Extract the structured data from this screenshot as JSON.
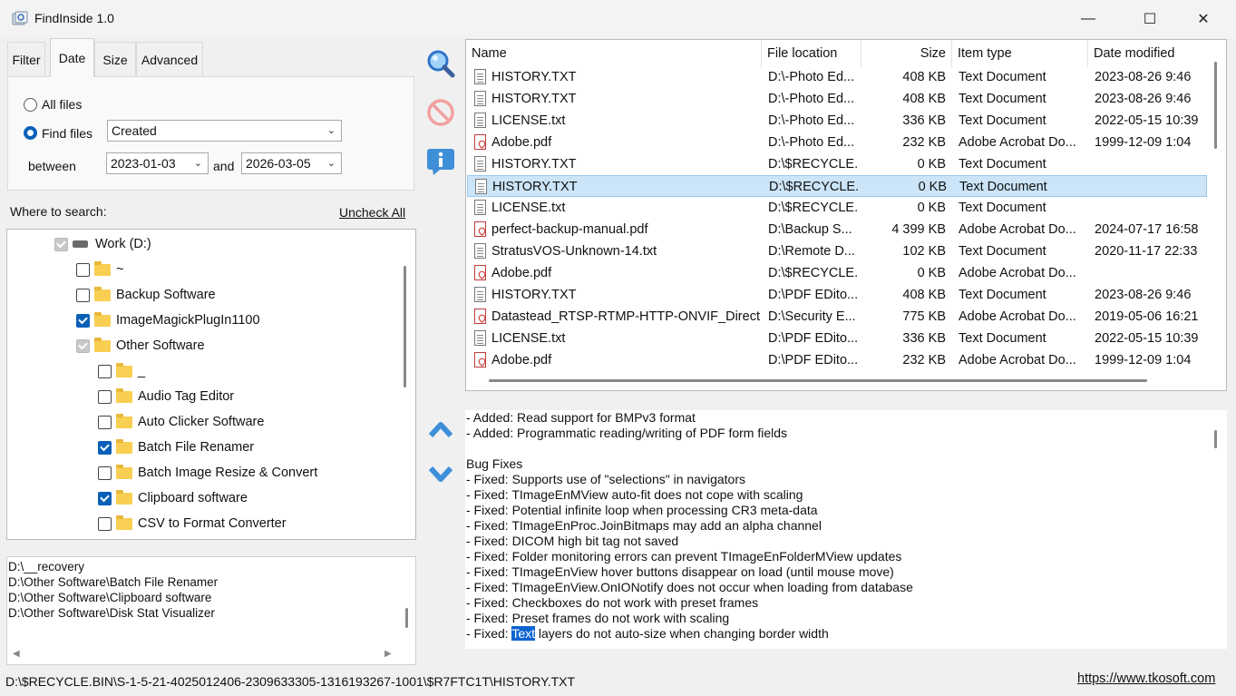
{
  "window": {
    "title": "FindInside 1.0",
    "minimize": "—",
    "maximize": "☐",
    "close": "✕"
  },
  "tabs": [
    {
      "label": "Filter"
    },
    {
      "label": "Date"
    },
    {
      "label": "Size"
    },
    {
      "label": "Advanced"
    }
  ],
  "date_filter": {
    "all_files_label": "All files",
    "find_files_label": "Find files",
    "mode_value": "Created",
    "between_label": "between",
    "start_date": "2023-01-03",
    "and_label": "and",
    "end_date": "2026-03-05"
  },
  "where_to_search": {
    "label": "Where to search:",
    "uncheck_all": "Uncheck All"
  },
  "tree": [
    {
      "label": "Work (D:)",
      "state": "gray",
      "level": 0,
      "kind": "drive"
    },
    {
      "label": "~",
      "state": "unchecked",
      "level": 1,
      "kind": "folder"
    },
    {
      "label": "Backup Software",
      "state": "unchecked",
      "level": 1,
      "kind": "folder"
    },
    {
      "label": "ImageMagickPlugIn1100",
      "state": "checked",
      "level": 1,
      "kind": "folder"
    },
    {
      "label": "Other Software",
      "state": "gray",
      "level": 1,
      "kind": "folder"
    },
    {
      "label": "_",
      "state": "unchecked",
      "level": 2,
      "kind": "folder"
    },
    {
      "label": "Audio Tag Editor",
      "state": "unchecked",
      "level": 2,
      "kind": "folder"
    },
    {
      "label": "Auto Clicker Software",
      "state": "unchecked",
      "level": 2,
      "kind": "folder"
    },
    {
      "label": "Batch File Renamer",
      "state": "checked",
      "level": 2,
      "kind": "folder"
    },
    {
      "label": "Batch Image Resize & Convert",
      "state": "unchecked",
      "level": 2,
      "kind": "folder"
    },
    {
      "label": "Clipboard software",
      "state": "checked",
      "level": 2,
      "kind": "folder"
    },
    {
      "label": "CSV to Format Converter",
      "state": "unchecked",
      "level": 2,
      "kind": "folder"
    }
  ],
  "search_paths": [
    "D:\\__recovery",
    "D:\\Other Software\\Batch File Renamer",
    "D:\\Other Software\\Clipboard software",
    "D:\\Other Software\\Disk Stat Visualizer"
  ],
  "side_buttons": {
    "search": "search-icon",
    "stop": "stop-icon",
    "info": "info-icon",
    "up": "chevron-up-icon",
    "down": "chevron-down-icon"
  },
  "file_columns": [
    "Name",
    "File location",
    "Size",
    "Item type",
    "Date modified"
  ],
  "files": [
    {
      "name": "HISTORY.TXT",
      "location": "D:\\-Photo Ed...",
      "size": "408 KB",
      "type": "Text Document",
      "date": "2023-08-26 9:46",
      "icon": "txt"
    },
    {
      "name": "HISTORY.TXT",
      "location": "D:\\-Photo Ed...",
      "size": "408 KB",
      "type": "Text Document",
      "date": "2023-08-26 9:46",
      "icon": "txt"
    },
    {
      "name": "LICENSE.txt",
      "location": "D:\\-Photo Ed...",
      "size": "336 KB",
      "type": "Text Document",
      "date": "2022-05-15 10:39",
      "icon": "txt"
    },
    {
      "name": "Adobe.pdf",
      "location": "D:\\-Photo Ed...",
      "size": "232 KB",
      "type": "Adobe Acrobat Do...",
      "date": "1999-12-09 1:04",
      "icon": "pdf"
    },
    {
      "name": "HISTORY.TXT",
      "location": "D:\\$RECYCLE...",
      "size": "0 KB",
      "type": "Text Document",
      "date": "",
      "icon": "txt"
    },
    {
      "name": "HISTORY.TXT",
      "location": "D:\\$RECYCLE...",
      "size": "0 KB",
      "type": "Text Document",
      "date": "",
      "icon": "txt",
      "selected": true
    },
    {
      "name": "LICENSE.txt",
      "location": "D:\\$RECYCLE...",
      "size": "0 KB",
      "type": "Text Document",
      "date": "",
      "icon": "txt"
    },
    {
      "name": "perfect-backup-manual.pdf",
      "location": "D:\\Backup S...",
      "size": "4 399 KB",
      "type": "Adobe Acrobat Do...",
      "date": "2024-07-17 16:58",
      "icon": "pdf"
    },
    {
      "name": "StratusVOS-Unknown-14.txt",
      "location": "D:\\Remote D...",
      "size": "102 KB",
      "type": "Text Document",
      "date": "2020-11-17 22:33",
      "icon": "txt"
    },
    {
      "name": "Adobe.pdf",
      "location": "D:\\$RECYCLE...",
      "size": "0 KB",
      "type": "Adobe Acrobat Do...",
      "date": "",
      "icon": "pdf"
    },
    {
      "name": "HISTORY.TXT",
      "location": "D:\\PDF EDito...",
      "size": "408 KB",
      "type": "Text Document",
      "date": "2023-08-26 9:46",
      "icon": "txt"
    },
    {
      "name": "Datastead_RTSP-RTMP-HTTP-ONVIF_Direct...",
      "location": "D:\\Security E...",
      "size": "775 KB",
      "type": "Adobe Acrobat Do...",
      "date": "2019-05-06 16:21",
      "icon": "pdf"
    },
    {
      "name": "LICENSE.txt",
      "location": "D:\\PDF EDito...",
      "size": "336 KB",
      "type": "Text Document",
      "date": "2022-05-15 10:39",
      "icon": "txt"
    },
    {
      "name": "Adobe.pdf",
      "location": "D:\\PDF EDito...",
      "size": "232 KB",
      "type": "Adobe Acrobat Do...",
      "date": "1999-12-09 1:04",
      "icon": "pdf"
    }
  ],
  "preview_lines": [
    "- Added: Read support for BMPv3 format",
    "- Added: Programmatic reading/writing of PDF form fields",
    "",
    "Bug Fixes",
    "- Fixed: Supports use of \"selections\" in navigators",
    "- Fixed: TImageEnMView auto-fit does not cope with scaling",
    "- Fixed: Potential infinite loop when processing CR3 meta-data",
    "- Fixed: TImageEnProc.JoinBitmaps may add an alpha channel",
    "- Fixed: DICOM high bit tag not saved",
    "- Fixed: Folder monitoring errors can prevent TImageEnFolderMView updates",
    "- Fixed: TImageEnView hover buttons disappear on load (until mouse move)",
    "- Fixed: TImageEnView.OnIONotify does not occur when loading from database",
    "- Fixed: Checkboxes do not work with preset frames",
    "- Fixed: Preset frames do not work with scaling"
  ],
  "preview_highlight_line": {
    "prefix": "- Fixed: ",
    "highlight": "Text",
    "suffix": " layers do not auto-size when changing border width"
  },
  "status": {
    "path": "D:\\$RECYCLE.BIN\\S-1-5-21-4025012406-2309633305-1316193267-1001\\$R7FTC1T\\HISTORY.TXT",
    "url": "https://www.tkosoft.com"
  }
}
